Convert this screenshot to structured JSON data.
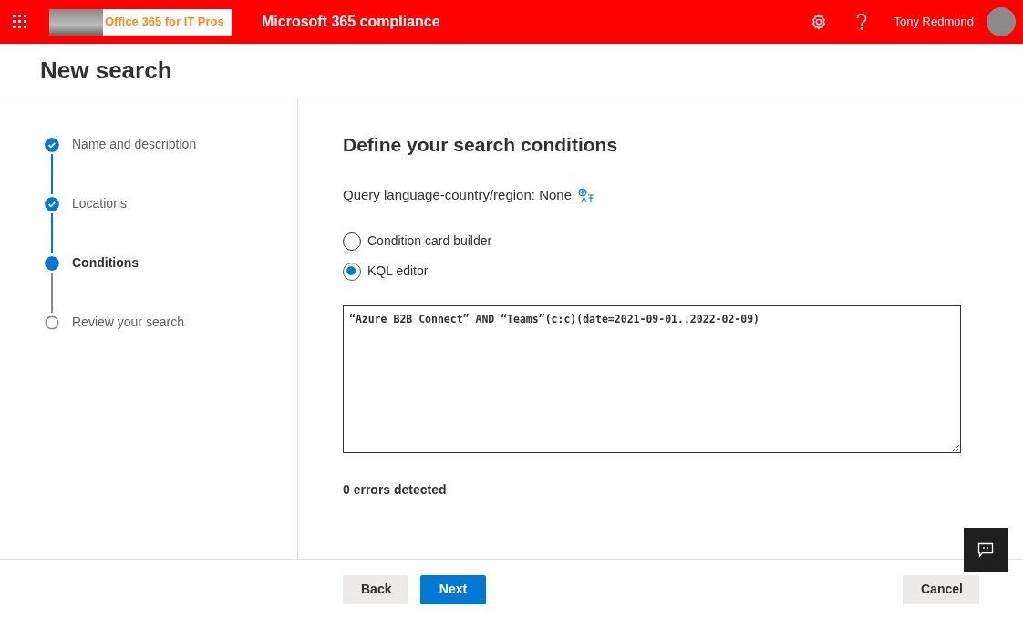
{
  "header": {
    "logo_text": "Office 365 for IT Pros",
    "app_title": "Microsoft 365 compliance",
    "user_name": "Tony Redmond"
  },
  "page_title": "New search",
  "steps": [
    {
      "label": "Name and description",
      "completed": true,
      "selected": false
    },
    {
      "label": "Locations",
      "completed": true,
      "selected": false
    },
    {
      "label": "Conditions",
      "completed": false,
      "selected": true
    },
    {
      "label": "Review your search",
      "completed": false,
      "selected": false
    }
  ],
  "content": {
    "heading": "Define your search conditions",
    "query_language": "Query language-country/region: None",
    "options": [
      {
        "label": "Condition card builder",
        "selected": false
      },
      {
        "label": "KQL editor",
        "selected": true
      }
    ],
    "query": "“Azure B2B Connect” AND “Teams”(c:c)(date=2021-09-01..2022-02-09)",
    "errors": "0 errors detected"
  },
  "footer": {
    "back": "Back",
    "next": "Next",
    "cancel": "Cancel"
  }
}
